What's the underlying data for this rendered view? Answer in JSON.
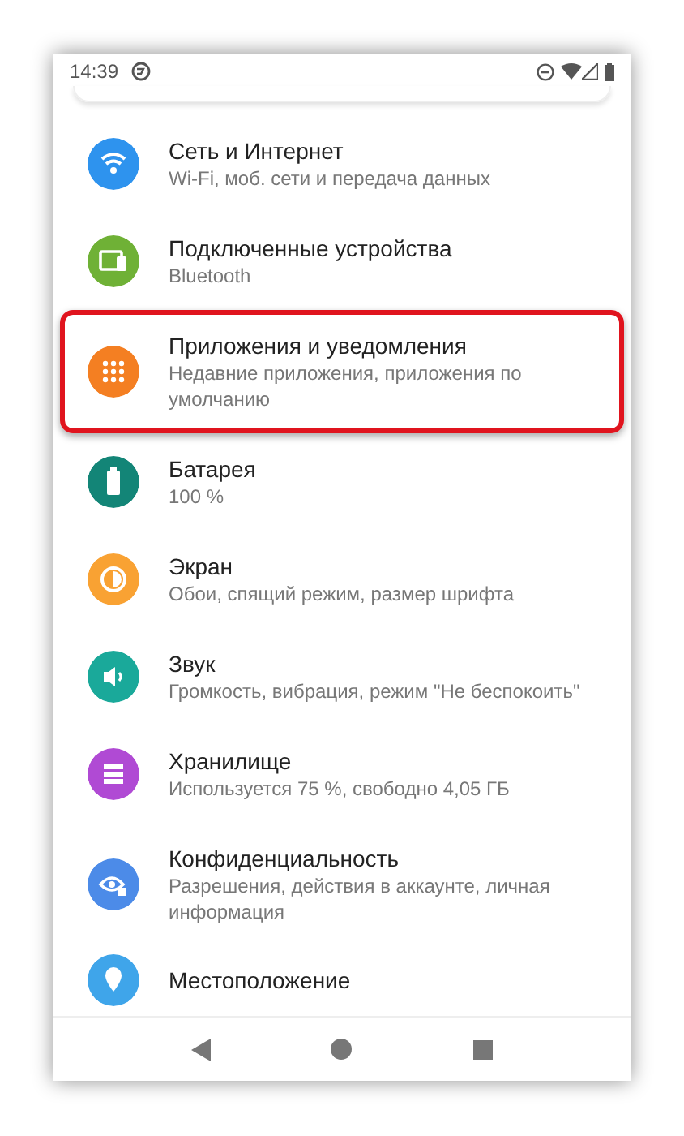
{
  "status_bar": {
    "time": "14:39"
  },
  "settings": [
    {
      "kind": "wifi",
      "title": "Сеть и Интернет",
      "subtitle": "Wi-Fi, моб. сети и передача данных",
      "color": "#2e93ee",
      "selected": false
    },
    {
      "kind": "devices",
      "title": "Подключенные устройства",
      "subtitle": "Bluetooth",
      "color": "#6fb136",
      "selected": false
    },
    {
      "kind": "apps",
      "title": "Приложения и уведомления",
      "subtitle": "Недавние приложения, приложения по умолчанию",
      "color": "#f47f22",
      "selected": true
    },
    {
      "kind": "battery",
      "title": "Батарея",
      "subtitle": "100 %",
      "color": "#138577",
      "selected": false
    },
    {
      "kind": "display",
      "title": "Экран",
      "subtitle": "Обои, спящий режим, размер шрифта",
      "color": "#f9a233",
      "selected": false
    },
    {
      "kind": "sound",
      "title": "Звук",
      "subtitle": "Громкость, вибрация, режим \"Не беспокоить\"",
      "color": "#1aa99a",
      "selected": false
    },
    {
      "kind": "storage",
      "title": "Хранилище",
      "subtitle": "Используется 75 %, свободно 4,05 ГБ",
      "color": "#b04ad4",
      "selected": false
    },
    {
      "kind": "privacy",
      "title": "Конфиденциальность",
      "subtitle": "Разрешения, действия в аккаунте, личная информация",
      "color": "#4c8be8",
      "selected": false
    },
    {
      "kind": "location",
      "title": "Местоположение",
      "color": "#3fa5ea",
      "selected": false
    }
  ]
}
